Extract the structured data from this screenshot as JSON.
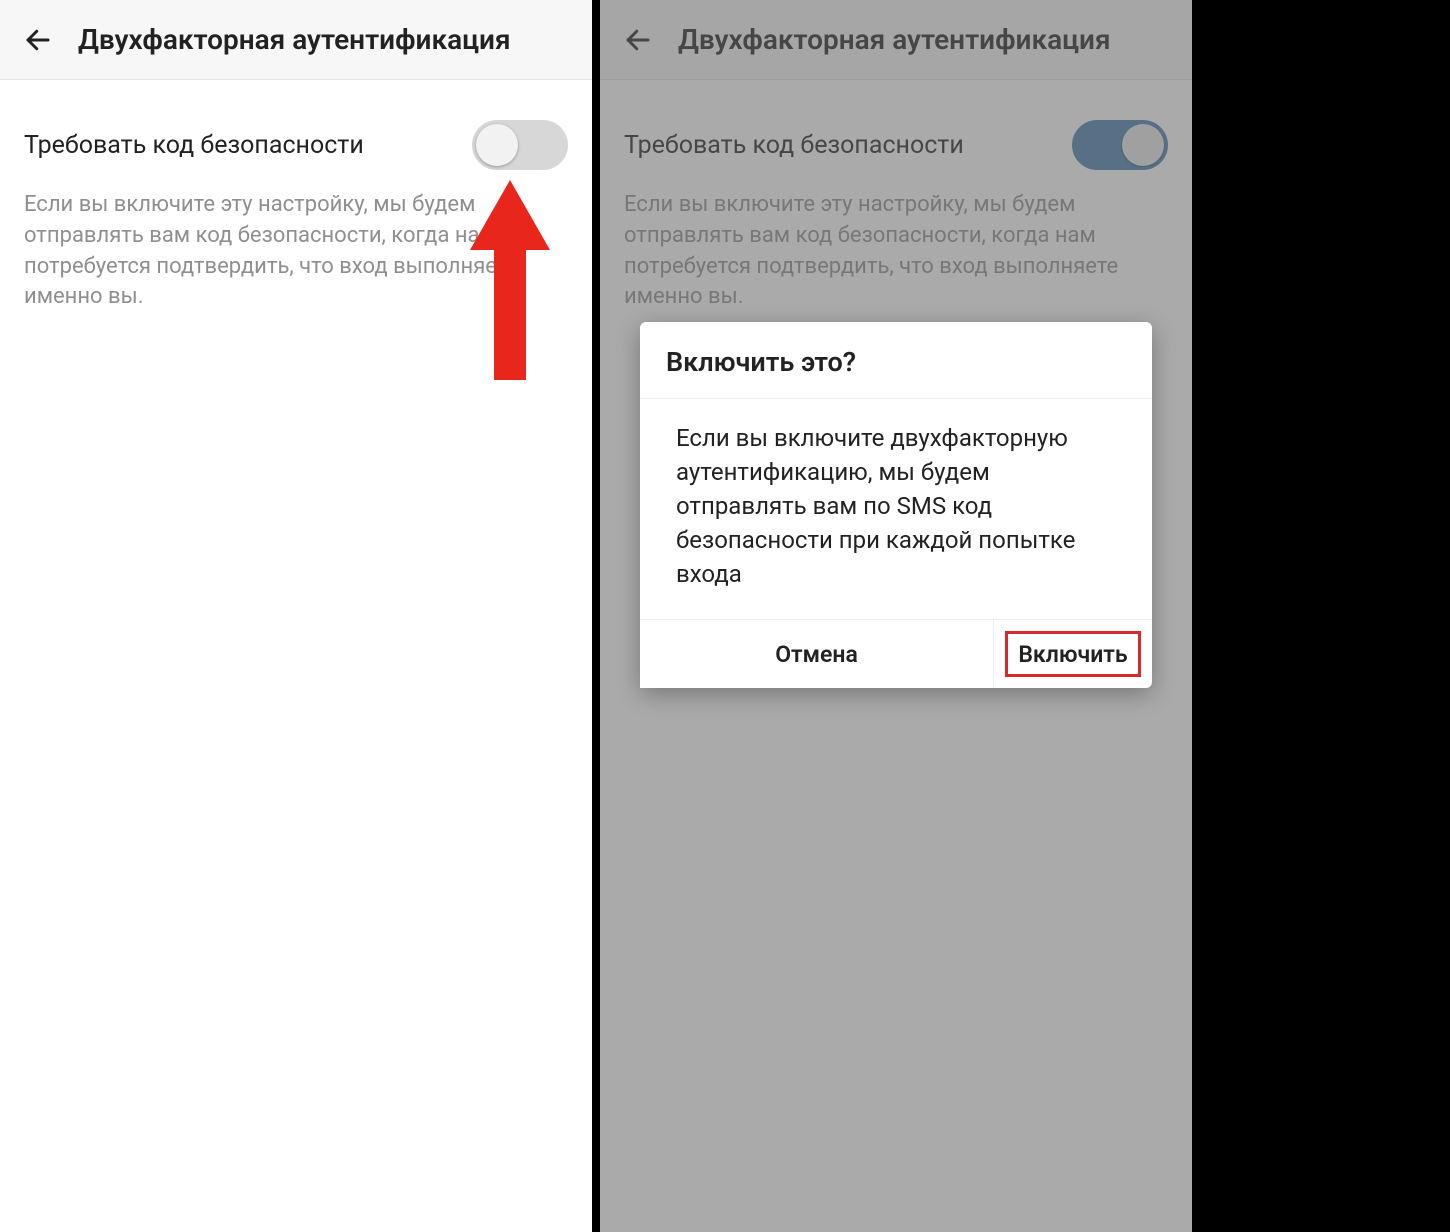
{
  "left": {
    "header_title": "Двухфакторная аутентификация",
    "row_label": "Требовать код безопасности",
    "description": "Если вы включите эту настройку, мы будем отправлять вам код безопасности, когда нам потребуется подтвердить, что вход выполняете именно вы.",
    "toggle_state": "off"
  },
  "right": {
    "header_title": "Двухфакторная аутентификация",
    "row_label": "Требовать код безопасности",
    "description": "Если вы включите эту настройку, мы будем отправлять вам код безопасности, когда нам потребуется подтвердить, что вход выполняете именно вы.",
    "toggle_state": "on",
    "dialog": {
      "title": "Включить это?",
      "body": "Если вы включите двухфакторную аутентификацию, мы будем отправлять вам по SMS код безопасности при каждой попытке входа",
      "cancel_label": "Отмена",
      "confirm_label": "Включить"
    }
  },
  "annotation": {
    "arrow_color": "#E8261B"
  }
}
